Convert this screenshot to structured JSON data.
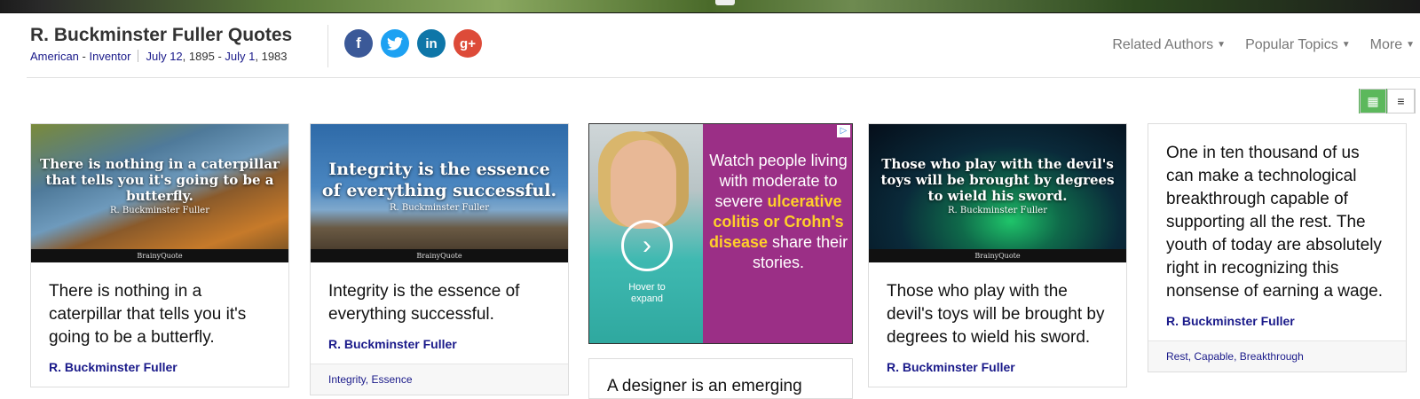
{
  "header": {
    "title": "R. Buckminster Fuller Quotes",
    "nationality": "American",
    "dash": " - ",
    "profession": "Inventor",
    "birth_md": "July 12",
    "birth_year": ", 1895",
    "range_dash": " - ",
    "death_md": "July 1",
    "death_year": ", 1983"
  },
  "social": [
    {
      "name": "facebook",
      "glyph": "f",
      "color": "#3b5998"
    },
    {
      "name": "twitter",
      "glyph": "t",
      "color": "#1da1f2"
    },
    {
      "name": "linkedin",
      "glyph": "in",
      "color": "#0e76a8"
    },
    {
      "name": "google-plus",
      "glyph": "g+",
      "color": "#dd4b39"
    }
  ],
  "nav": {
    "related_authors": "Related Authors",
    "popular_topics": "Popular Topics",
    "more": "More"
  },
  "view_toggle": {
    "grid_icon": "grid-icon",
    "list_icon": "list-icon",
    "active": "grid",
    "active_color": "#5cb85c"
  },
  "cards": [
    {
      "image_text": "There is nothing in a caterpillar that tells you it's going to be a butterfly.",
      "image_author": "R. Buckminster Fuller",
      "image_brand": "BrainyQuote",
      "quote": "There is nothing in a caterpillar that tells you it's going to be a butterfly.",
      "author": "R. Buckminster Fuller"
    },
    {
      "image_text": "Integrity is the essence of everything successful.",
      "image_author": "R. Buckminster Fuller",
      "image_brand": "BrainyQuote",
      "quote": "Integrity is the essence of everything successful.",
      "author": "R. Buckminster Fuller",
      "tags": [
        "Integrity",
        "Essence"
      ]
    },
    {
      "image_text": "Those who play with the devil's toys will be brought by degrees to wield his sword.",
      "image_author": "R. Buckminster Fuller",
      "image_brand": "BrainyQuote",
      "quote": "Those who play with the devil's toys will be brought by degrees to wield his sword.",
      "author": "R. Buckminster Fuller"
    },
    {
      "quote": "One in ten thousand of us can make a technological breakthrough capable of supporting all the rest. The youth of today are absolutely right in recognizing this nonsense of earning a wage.",
      "author": "R. Buckminster Fuller",
      "tags": [
        "Rest",
        "Capable",
        "Breakthrough"
      ]
    },
    {
      "quote": "A designer is an emerging"
    }
  ],
  "ad": {
    "line1": "Watch people living with moderate to severe",
    "highlight": "ulcerative colitis or Crohn's disease",
    "line2": "share their stories.",
    "hover_text": "Hover to expand",
    "badge": "▷"
  }
}
